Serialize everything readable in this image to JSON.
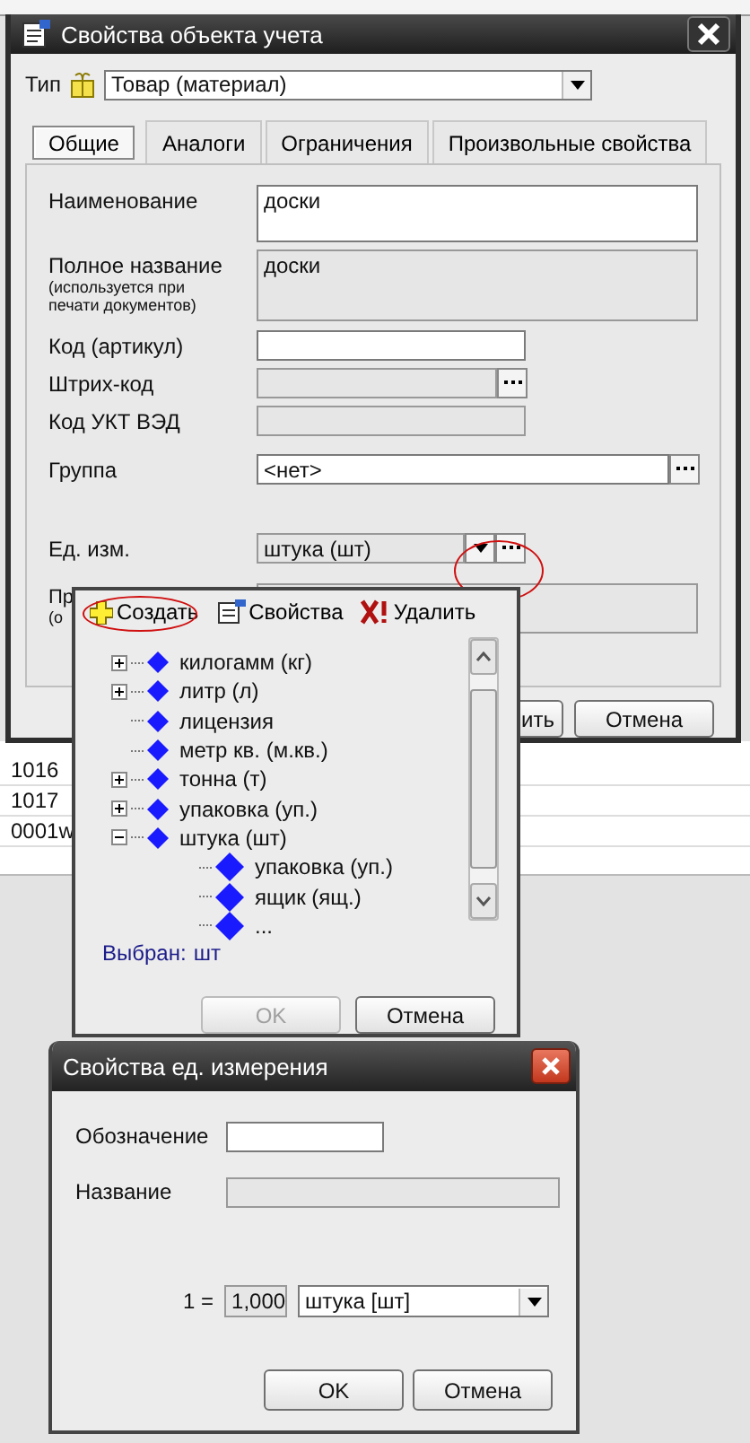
{
  "background_table": {
    "rows": [
      {
        "code": "1016"
      },
      {
        "code": "1017"
      },
      {
        "code": "0001w"
      }
    ]
  },
  "main_window": {
    "title": "Свойства объекта учета",
    "type_label": "Тип",
    "type_value": "Товар (материал)",
    "tabs": [
      {
        "label": "Общие",
        "selected": true
      },
      {
        "label": "Аналоги",
        "selected": false
      },
      {
        "label": "Ограничения",
        "selected": false
      },
      {
        "label": "Произвольные свойства",
        "selected": false
      }
    ],
    "fields": [
      {
        "kind": "multiline",
        "label": "Наименование",
        "value": "доски",
        "disabled": false
      },
      {
        "kind": "multiline",
        "label": "Полное название",
        "note": "(используется при печати документов)",
        "value": "доски",
        "disabled": true
      },
      {
        "kind": "text",
        "label": "Код (артикул)",
        "disabled": false
      },
      {
        "kind": "browse",
        "label": "Штрих-код",
        "disabled": true
      },
      {
        "kind": "text",
        "label": "Код УКТ ВЭД",
        "disabled": true
      },
      {
        "kind": "browse_wide",
        "label": "Группа",
        "value": "<нет>",
        "disabled": false
      },
      {
        "kind": "combo_browse",
        "label": "Ед. изм.",
        "value": "штука (шт)",
        "disabled": true
      },
      {
        "kind": "covered",
        "label": "Пр",
        "note": "(о",
        "disabled": true
      }
    ],
    "buttons": [
      {
        "label": "ить"
      },
      {
        "label": "Отмена"
      }
    ]
  },
  "unit_popup": {
    "toolbar": [
      {
        "kind": "create",
        "label": "Создать"
      },
      {
        "kind": "properties",
        "label": "Свойства"
      },
      {
        "kind": "delete",
        "label": "Удалить"
      }
    ],
    "tree": [
      {
        "label": "килогамм (кг)",
        "expanded": false
      },
      {
        "label": "литр (л)",
        "expanded": false
      },
      {
        "label": "лицензия"
      },
      {
        "label": "метр кв. (м.кв.)"
      },
      {
        "label": "тонна (т)",
        "expanded": false
      },
      {
        "label": "упаковка (уп.)",
        "expanded": false
      },
      {
        "label": "штука (шт)",
        "expanded": true,
        "children": [
          {
            "label": "упаковка (уп.)"
          },
          {
            "label": "ящик (ящ.)"
          },
          {
            "label": "..."
          }
        ]
      }
    ],
    "status_label": "Выбран:",
    "status_value": "шт",
    "buttons": [
      {
        "label": "OK",
        "disabled": true
      },
      {
        "label": "Отмена",
        "disabled": false
      }
    ]
  },
  "unit_dialog": {
    "title": "Свойства ед. измерения",
    "designation_label": "Обозначение",
    "name_label": "Название",
    "ratio_label": "1 =",
    "ratio_value": "1,000",
    "ratio_unit": "штука [шт]",
    "buttons": [
      {
        "label": "OK"
      },
      {
        "label": "Отмена"
      }
    ]
  }
}
